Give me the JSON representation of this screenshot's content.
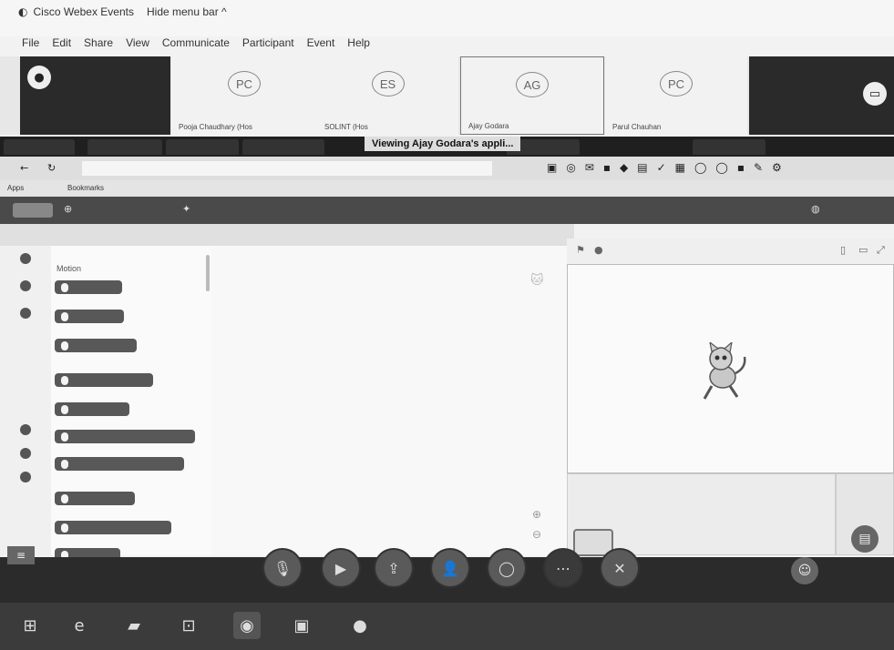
{
  "app": {
    "title": "Cisco Webex Events",
    "hide_menu": "Hide menu bar ^"
  },
  "menu": [
    "File",
    "Edit",
    "Share",
    "View",
    "Communicate",
    "Participant",
    "Event",
    "Help"
  ],
  "participants": [
    {
      "initials": "PC",
      "name": "Pooja Chaudhary (Hos"
    },
    {
      "initials": "ES",
      "name": "SOLINT (Hos"
    },
    {
      "initials": "AG",
      "name": "Ajay Godara"
    },
    {
      "initials": "PC",
      "name": "Parul Chauhan"
    }
  ],
  "browser": {
    "viewing": "Viewing Ajay Godara's appli...",
    "tabs": [
      "",
      "",
      "",
      "",
      "",
      ""
    ],
    "address": "",
    "bookmarks": [
      "Apps",
      "Bookmarks",
      "",
      "",
      "",
      "",
      "",
      "",
      "",
      "",
      ""
    ]
  },
  "scratch": {
    "tabs": [
      "",
      "",
      ""
    ],
    "palette_heading": "Motion",
    "categories": [
      "",
      "",
      "",
      "",
      "",
      "",
      "",
      "",
      ""
    ],
    "blocks": [
      {
        "text": "",
        "input": ""
      },
      {
        "text": "",
        "input": ""
      },
      {
        "text": "",
        "input": ""
      },
      {
        "text": "",
        "input": ""
      },
      {
        "text": "",
        "input": ""
      },
      {
        "text": "",
        "input": ""
      },
      {
        "text": "",
        "input": ""
      },
      {
        "text": "",
        "input": ""
      },
      {
        "text": "",
        "input": ""
      },
      {
        "text": "",
        "input": ""
      },
      {
        "text": "",
        "input": ""
      }
    ],
    "sprite_labels": [
      "",
      "",
      "",
      "",
      "",
      ""
    ]
  },
  "controls": [
    {
      "icon": "mic-off-icon",
      "glyph": "🎙"
    },
    {
      "icon": "video-icon",
      "glyph": "▶"
    },
    {
      "icon": "share-icon",
      "glyph": "⇪"
    },
    {
      "icon": "participants-icon",
      "glyph": "👤"
    },
    {
      "icon": "chat-icon",
      "glyph": "◯"
    },
    {
      "icon": "more-icon",
      "glyph": "⋯"
    },
    {
      "icon": "end-call-icon",
      "glyph": "✕"
    }
  ]
}
